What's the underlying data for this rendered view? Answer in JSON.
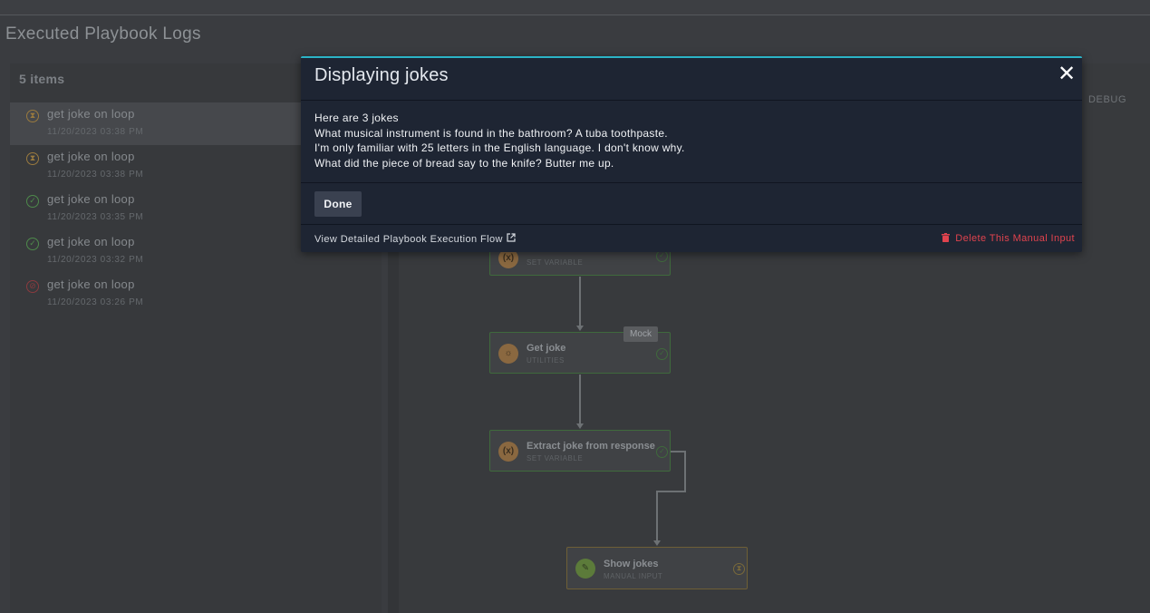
{
  "page": {
    "title": "Executed Playbook Logs",
    "items_count": "5 items",
    "debug_label": "DEBUG"
  },
  "logs": [
    {
      "name": "get joke on loop",
      "date": "11/20/2023 03:38 PM",
      "status": "pending",
      "icon": "hourglass-icon"
    },
    {
      "name": "get joke on loop",
      "date": "11/20/2023 03:38 PM",
      "status": "pending",
      "icon": "hourglass-icon"
    },
    {
      "name": "get joke on loop",
      "date": "11/20/2023 03:35 PM",
      "status": "success",
      "icon": "check-circle-icon"
    },
    {
      "name": "get joke on loop",
      "date": "11/20/2023 03:32 PM",
      "status": "success",
      "icon": "check-circle-icon"
    },
    {
      "name": "get joke on loop",
      "date": "11/20/2023 03:26 PM",
      "status": "error",
      "icon": "error-circle-icon"
    }
  ],
  "flow": {
    "nodes": [
      {
        "name": "",
        "type": "SET VARIABLE"
      },
      {
        "name": "Get joke",
        "type": "UTILITIES",
        "tag": "Mock"
      },
      {
        "name": "Extract joke from response",
        "type": "SET VARIABLE"
      },
      {
        "name": "Show jokes",
        "type": "MANUAL INPUT"
      }
    ]
  },
  "modal": {
    "title": "Displaying jokes",
    "lines": [
      "Here are 3 jokes",
      "What musical instrument is found in the bathroom? A tuba toothpaste.",
      "I'm only familiar with 25 letters in the English language. I don't know why.",
      "What did the piece of bread say to the knife? Butter me up."
    ],
    "done_label": "Done",
    "view_flow_label": "View Detailed Playbook Execution Flow",
    "delete_label": "Delete This Manual Input",
    "close_symbol": "✕"
  },
  "colors": {
    "accent": "#2bb3c6",
    "danger": "#e0434e",
    "modal_bg": "#1e2533"
  }
}
